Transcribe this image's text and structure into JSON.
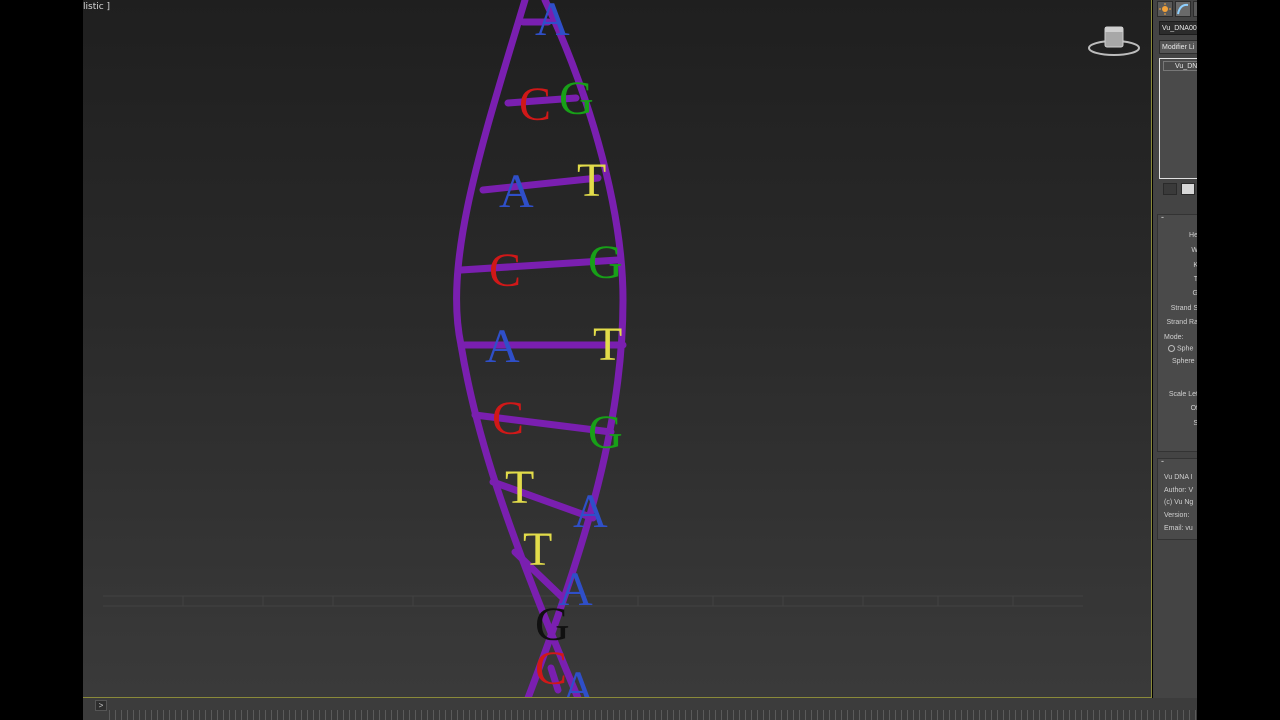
{
  "viewport": {
    "label": "listic ]",
    "helix": {
      "strand_color": "#7a1fb0",
      "rungs": [
        {
          "left": "",
          "right": "A",
          "left_color": "#2f4fc8",
          "right_color": "#2f4fc8"
        },
        {
          "left": "C",
          "right": "G",
          "left_color": "#d01818",
          "right_color": "#18a018"
        },
        {
          "left": "A",
          "right": "T",
          "left_color": "#2f4fc8",
          "right_color": "#e2dc4a"
        },
        {
          "left": "C",
          "right": "G",
          "left_color": "#d01818",
          "right_color": "#18a018"
        },
        {
          "left": "A",
          "right": "T",
          "left_color": "#2f4fc8",
          "right_color": "#e2dc4a"
        },
        {
          "left": "C",
          "right": "G",
          "left_color": "#d01818",
          "right_color": "#18a018"
        },
        {
          "left": "T",
          "right": "A",
          "left_color": "#e2dc4a",
          "right_color": "#2f4fc8"
        },
        {
          "left": "T",
          "right": "A",
          "left_color": "#e2dc4a",
          "right_color": "#2f4fc8"
        },
        {
          "left": "G",
          "right": "",
          "left_color": "#101010",
          "right_color": "#101010"
        },
        {
          "left": "C",
          "right": "A",
          "left_color": "#d01818",
          "right_color": "#2f4fc8"
        }
      ]
    }
  },
  "command_panel": {
    "object_name": "Vu_DNA00",
    "modifier_list": "Modifier Li",
    "stack_item": "Vu_DN",
    "params": [
      "He",
      "W",
      "K",
      "T",
      "G",
      "Strand S",
      "Strand Ra",
      "Mode:",
      "Sphe",
      "Sphere",
      "Scale Let",
      "Of",
      "S"
    ],
    "about": [
      "Vu DNA I",
      "Author: V",
      "(c) Vu Ng",
      "Version:",
      "Email: vu"
    ]
  },
  "timebar": {
    "next_label": ">"
  }
}
